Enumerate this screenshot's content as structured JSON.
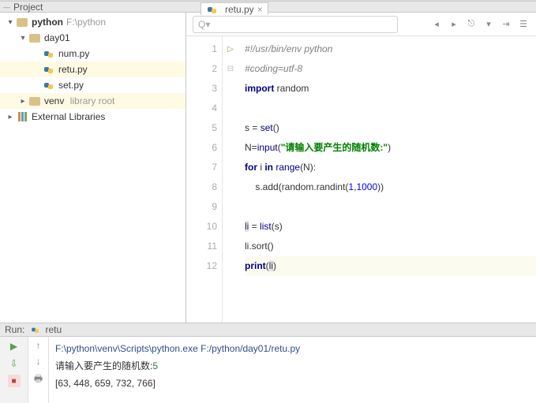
{
  "titlebar": {
    "label": "Project"
  },
  "tree": {
    "root": {
      "name": "python",
      "path": "F:\\python"
    },
    "day01": {
      "name": "day01"
    },
    "files": {
      "num": "num.py",
      "retu": "retu.py",
      "set": "set.py"
    },
    "venv": {
      "name": "venv",
      "hint": "library root"
    },
    "ext": "External Libraries"
  },
  "tab": {
    "name": "retu.py"
  },
  "search": {
    "placeholder": "",
    "icon": "Q▾"
  },
  "gutter": [
    "1",
    "2",
    "3",
    "4",
    "5",
    "6",
    "7",
    "8",
    "9",
    "10",
    "11",
    "12"
  ],
  "code": {
    "l1a": "#!/usr/bin/env python",
    "l2a": "#coding=utf-8",
    "l3a": "import",
    "l3b": " random",
    "l5a": "s = ",
    "l5b": "set",
    "l5c": "()",
    "l6a": "N=",
    "l6b": "input",
    "l6c": "(",
    "l6d": "\"请输入要产生的随机数:\"",
    "l6e": ")",
    "l7a": "for",
    "l7b": " i ",
    "l7c": "in",
    "l7d": " ",
    "l7e": "range",
    "l7f": "(N):",
    "l8a": "    s.add(random.randint(",
    "l8b": "1",
    "l8c": ",",
    "l8d": "1000",
    "l8e": "))",
    "l10a": "li",
    "l10b": " = ",
    "l10c": "list",
    "l10d": "(s)",
    "l11a": "li.sort()",
    "l12a": "print",
    "l12b": "(",
    "l12c": "li",
    "l12d": ")"
  },
  "runbar": {
    "left": "Run:",
    "name": "retu"
  },
  "console": {
    "exe": "F:\\python\\venv\\Scripts\\python.exe F:/python/day01/retu.py",
    "prompt": "请输入要产生的随机数:",
    "input": "5",
    "out": "[63, 448, 659, 732, 766]"
  }
}
